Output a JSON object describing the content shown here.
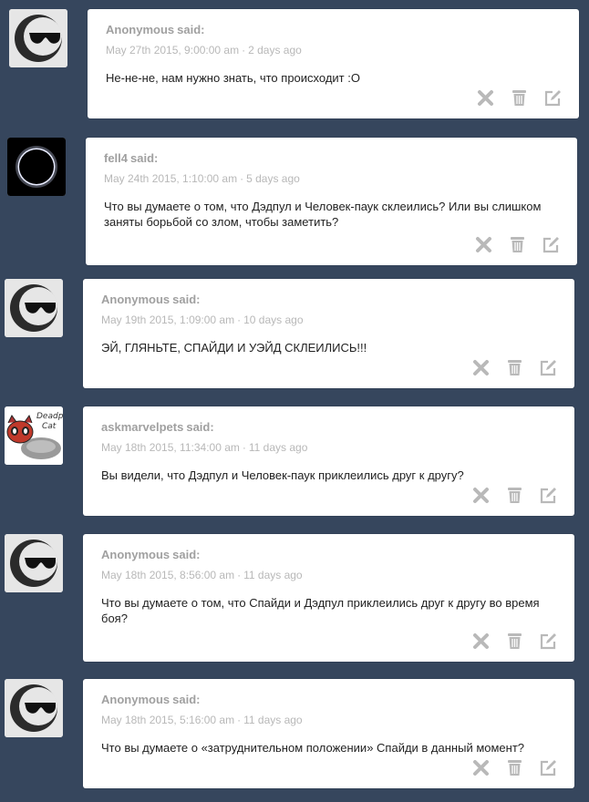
{
  "said_label": "said:",
  "date_separator": "·",
  "icons": {
    "delete": "x-icon",
    "trash": "trash-icon",
    "edit": "edit-icon"
  },
  "colors": {
    "background": "#36465d",
    "card": "#ffffff",
    "meta_text": "#a0a0a0"
  },
  "posts": [
    {
      "asker": "Anonymous",
      "date": "May 27th 2015, 9:00:00 am",
      "ago": "2 days ago",
      "text": "Не-не-не, нам нужно знать, что происходит :O",
      "avatar": "anonymous-sunglasses"
    },
    {
      "asker": "fell4",
      "date": "May 24th 2015, 1:10:00 am",
      "ago": "5 days ago",
      "text": "Что вы думаете о том, что Дэдпул и Человек-паук склеились? Или вы слишком заняты борьбой со злом, чтобы заметить?",
      "avatar": "eclipse"
    },
    {
      "asker": "Anonymous",
      "date": "May 19th 2015, 1:09:00 am",
      "ago": "10 days ago",
      "text": "ЭЙ, ГЛЯНЬТЕ, СПАЙДИ И УЭЙД СКЛЕИЛИСЬ!!!",
      "avatar": "anonymous-sunglasses"
    },
    {
      "asker": "askmarvelpets",
      "date": "May 18th 2015, 11:34:00 am",
      "ago": "11 days ago",
      "text": "Вы видели, что Дэдпул и Человек-паук приклеились друг к другу?",
      "avatar": "deadpool-cat",
      "avatar_caption": "Deadpool Cat"
    },
    {
      "asker": "Anonymous",
      "date": "May 18th 2015, 8:56:00 am",
      "ago": "11 days ago",
      "text": "Что вы думаете о том, что Спайди и Дэдпул приклеились друг к другу во время боя?",
      "avatar": "anonymous-sunglasses"
    },
    {
      "asker": "Anonymous",
      "date": "May 18th 2015, 5:16:00 am",
      "ago": "11 days ago",
      "text": "Что вы думаете о «затруднительном положении» Спайди в данный момент?",
      "avatar": "anonymous-sunglasses"
    }
  ]
}
